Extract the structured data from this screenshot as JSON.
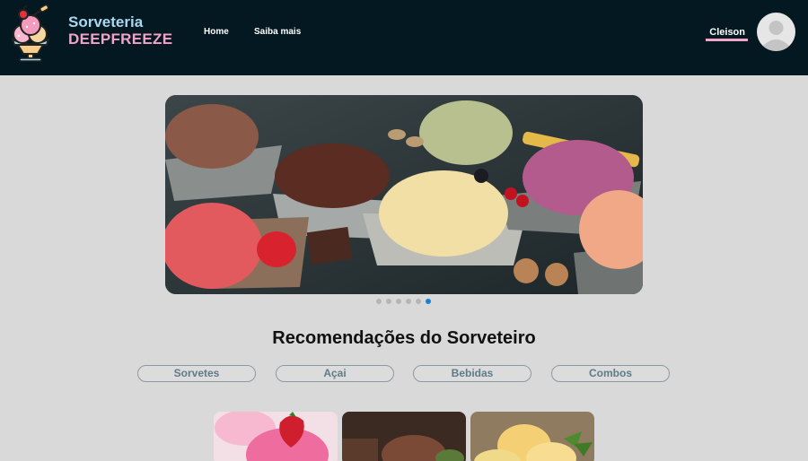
{
  "brand": {
    "line1": "Sorveteria",
    "line2": "DEEPFREEZE"
  },
  "nav": {
    "home": "Home",
    "saiba_mais": "Saiba mais"
  },
  "user": {
    "name": "Cleison"
  },
  "carousel": {
    "slide_count": 6,
    "active_index": 5
  },
  "section": {
    "title": "Recomendações do Sorveteiro"
  },
  "categories": [
    "Sorvetes",
    "Açai",
    "Bebidas",
    "Combos"
  ],
  "colors": {
    "header_bg": "#031820",
    "brand_light_blue": "#a9d8f0",
    "brand_pink": "#f4a3c8",
    "page_bg": "#d9d9d9",
    "active_dot": "#1b7fd6"
  }
}
